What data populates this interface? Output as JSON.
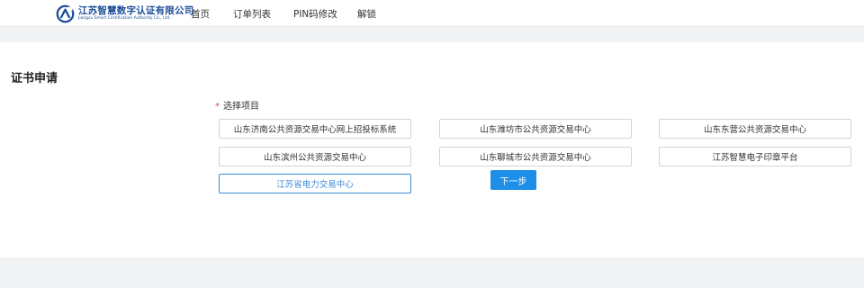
{
  "header": {
    "logo_title": "江苏智慧数字认证有限公司",
    "logo_subtitle": "Jiangsu Smart Certification Authority Co., Ltd.",
    "nav": [
      "首页",
      "订单列表",
      "PIN码修改",
      "解锁"
    ]
  },
  "page": {
    "title": "证书申请",
    "field_label": "选择项目",
    "required_mark": "*",
    "options": [
      {
        "label": "山东济南公共资源交易中心网上招投标系统",
        "selected": false
      },
      {
        "label": "山东潍坊市公共资源交易中心",
        "selected": false
      },
      {
        "label": "山东东营公共资源交易中心",
        "selected": false
      },
      {
        "label": "山东滨州公共资源交易中心",
        "selected": false
      },
      {
        "label": "山东聊城市公共资源交易中心",
        "selected": false
      },
      {
        "label": "江苏智慧电子印章平台",
        "selected": false
      },
      {
        "label": "江苏省电力交易中心",
        "selected": true
      }
    ],
    "next_button": "下一步"
  },
  "colors": {
    "brand": "#1d4e9a",
    "accent": "#1e8fe8",
    "selected_border": "#3d8bd6",
    "required": "#e53935",
    "page_bg": "#f1f2f4"
  },
  "icons": {
    "logo": "company-logo-icon"
  }
}
